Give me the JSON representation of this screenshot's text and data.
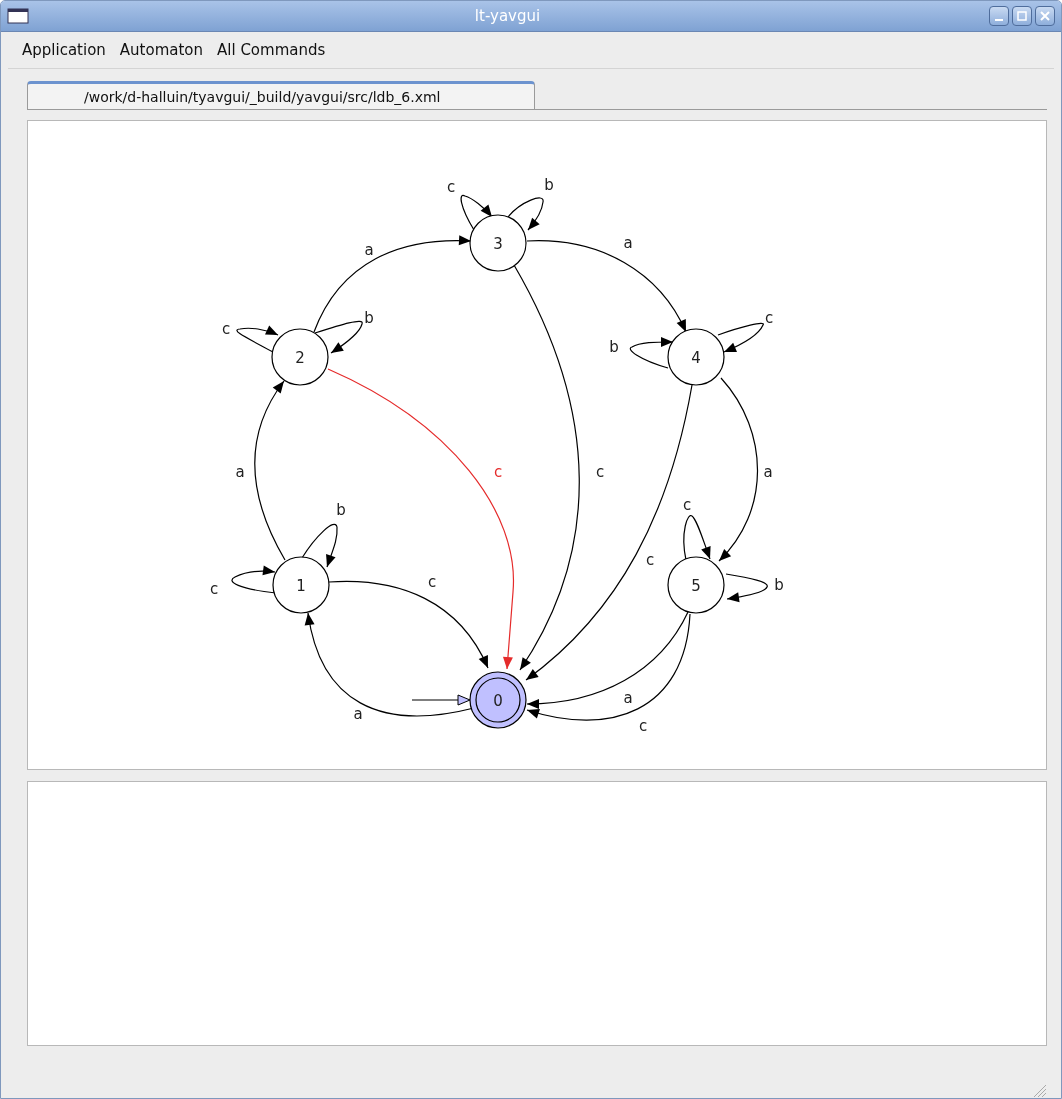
{
  "window": {
    "title": "lt-yavgui"
  },
  "menu": [
    "Application",
    "Automaton",
    "All Commands"
  ],
  "tabs": [
    {
      "label": "/work/d-halluin/tyavgui/_build/yavgui/src/ldb_6.xml",
      "selected": true
    }
  ],
  "graph": {
    "nodes": [
      {
        "label": "0",
        "initial": true,
        "accepting": true,
        "highlighted": true
      },
      {
        "label": "1",
        "initial": false,
        "accepting": false,
        "highlighted": false
      },
      {
        "label": "2",
        "initial": false,
        "accepting": false,
        "highlighted": false
      },
      {
        "label": "3",
        "initial": false,
        "accepting": false,
        "highlighted": false
      },
      {
        "label": "4",
        "initial": false,
        "accepting": false,
        "highlighted": false
      },
      {
        "label": "5",
        "initial": false,
        "accepting": false,
        "highlighted": false
      }
    ],
    "edges": [
      {
        "label": "c",
        "selected": false
      },
      {
        "label": "c",
        "selected": true
      },
      {
        "label": "c",
        "selected": false
      },
      {
        "label": "c",
        "selected": false
      },
      {
        "label": "a",
        "selected": false
      },
      {
        "label": "c",
        "selected": false
      },
      {
        "label": "a",
        "selected": false
      },
      {
        "label": "a",
        "selected": false
      },
      {
        "label": "a",
        "selected": false
      },
      {
        "label": "a",
        "selected": false
      },
      {
        "label": "a",
        "selected": false
      },
      {
        "label": "b",
        "selected": false
      },
      {
        "label": "c",
        "selected": false
      },
      {
        "label": "c",
        "selected": false
      },
      {
        "label": "b",
        "selected": false
      },
      {
        "label": "c",
        "selected": false
      },
      {
        "label": "b",
        "selected": false
      },
      {
        "label": "b",
        "selected": false
      },
      {
        "label": "c",
        "selected": false
      },
      {
        "label": "c",
        "selected": false
      },
      {
        "label": "b",
        "selected": false
      }
    ]
  }
}
